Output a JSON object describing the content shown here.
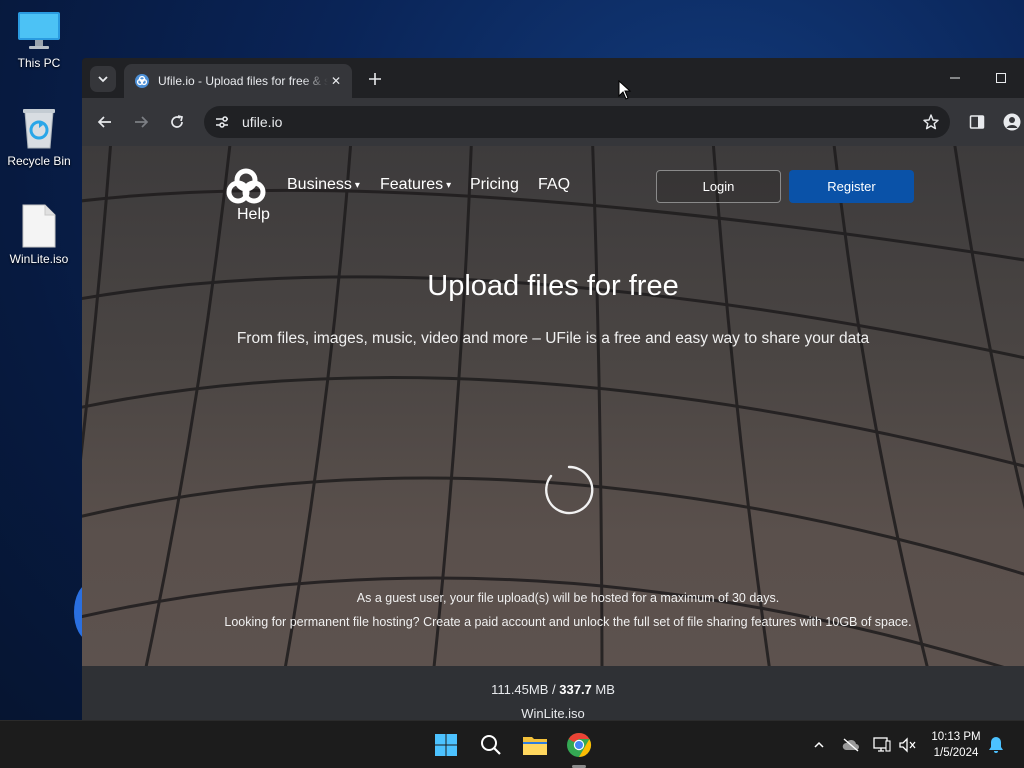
{
  "desktop": {
    "icons": [
      {
        "label": "This PC",
        "icon": "monitor-icon"
      },
      {
        "label": "Recycle Bin",
        "icon": "recycle-bin-icon"
      },
      {
        "label": "WinLite.iso",
        "icon": "file-icon"
      }
    ]
  },
  "browser": {
    "tab": {
      "title": "Ufile.io - Upload files for free & share",
      "favicon": "ufile-favicon-icon"
    },
    "address": "ufile.io"
  },
  "site": {
    "nav": {
      "business": "Business",
      "features": "Features",
      "pricing": "Pricing",
      "faq": "FAQ",
      "help": "Help",
      "login": "Login",
      "register": "Register"
    },
    "hero": {
      "title": "Upload files for free",
      "subtitle": "From files, images, music, video and more – UFile is a free and easy way to share your data"
    },
    "guest_note": {
      "line1": "As a guest user, your file upload(s) will be hosted for a maximum of 30 days.",
      "line2": "Looking for permanent file hosting? Create a paid account and unlock the full set of file sharing features with 10GB of space."
    },
    "upload": {
      "uploaded": "111.45MB",
      "separator": " / ",
      "total_value": "337.7",
      "total_unit": " MB",
      "filename": "WinLite.iso"
    }
  },
  "taskbar": {
    "time": "10:13 PM",
    "date": "1/5/2024"
  },
  "colors": {
    "register_button": "#0a52a8",
    "upload_bar": "#2f3135",
    "taskbar": "#1c1c1c"
  }
}
